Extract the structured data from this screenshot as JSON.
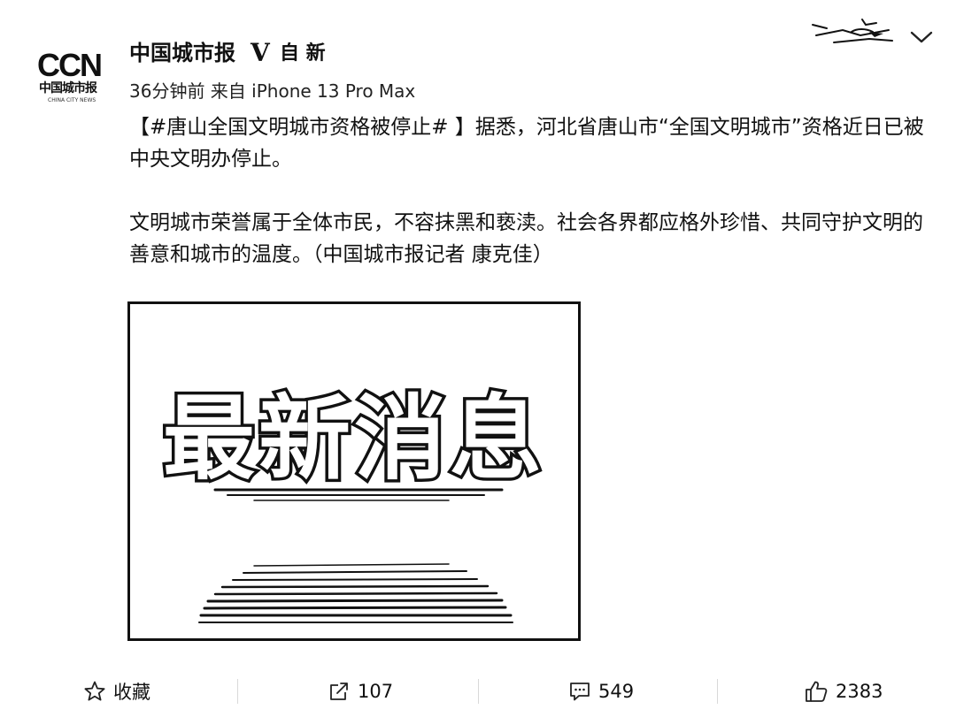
{
  "header": {
    "avatar_logo": "CCN",
    "avatar_logo_cn": "中国城市报",
    "avatar_logo_en": "CHINA CITY NEWS",
    "account_name": "中国城市报",
    "verified_mark": "V",
    "vip_badge": "自 新",
    "meta": "36分钟前 来自 iPhone 13 Pro Max",
    "menu_icon": "chevron-down-icon"
  },
  "post": {
    "hashtag": "【#唐山全国文明城市资格被停止# 】",
    "paragraph1_rest": "据悉，河北省唐山市“全国文明城市”资格近日已被中央文明办停止。",
    "paragraph2": "文明城市荣誉属于全体市民，不容抹黑和亵渎。社会各界都应格外珍惜、共同守护文明的善意和城市的温度。（中国城市报记者 康克佳）",
    "image_text": "最新消息"
  },
  "actions": {
    "favorite": {
      "icon": "star-icon",
      "label": "收藏"
    },
    "repost": {
      "icon": "repost-icon",
      "label": "107"
    },
    "comment": {
      "icon": "comment-icon",
      "label": "549"
    },
    "like": {
      "icon": "thumbs-up-icon",
      "label": "2383"
    }
  },
  "colors": {
    "text": "#111111",
    "background": "#ffffff",
    "divider": "#d9d9d9"
  }
}
